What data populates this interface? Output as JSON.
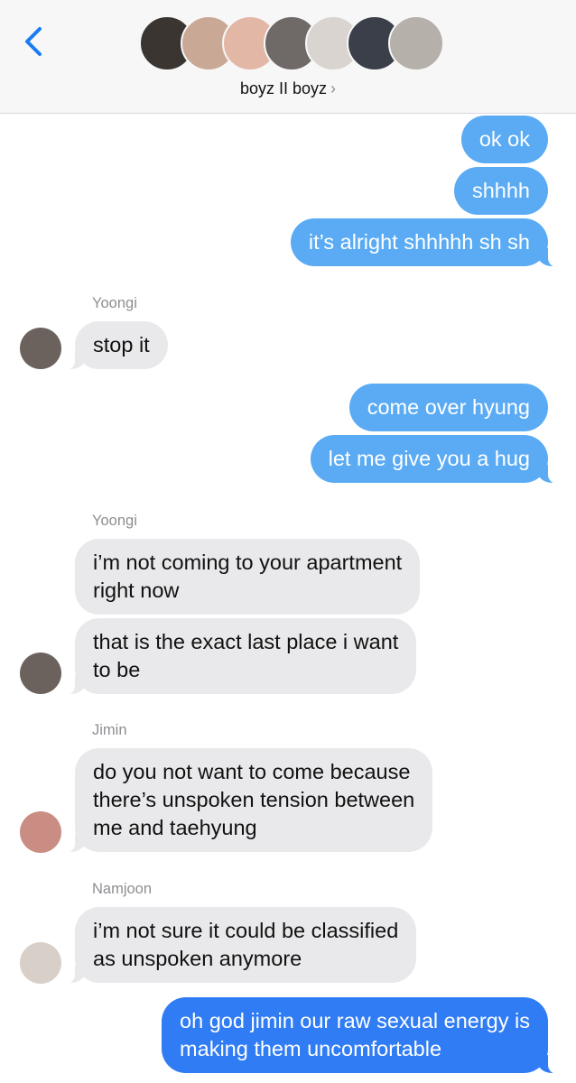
{
  "header": {
    "group_name": "boyz II boyz",
    "chevron": "›",
    "back_icon": "chevron-left-icon",
    "avatar_colors": [
      "#3b3532",
      "#c9a996",
      "#e3b7a6",
      "#6f6a68",
      "#d9d4cf",
      "#3a3f4a",
      "#b6b0aa"
    ]
  },
  "messages": [
    {
      "from": "me",
      "text": "ok ok"
    },
    {
      "from": "me",
      "text": "shhhh"
    },
    {
      "from": "me",
      "text": "it’s alright shhhhh sh sh"
    },
    {
      "sender": "Yoongi",
      "text": "stop it"
    },
    {
      "from": "me",
      "text": "come over hyung"
    },
    {
      "from": "me",
      "text": "let me give you a hug"
    },
    {
      "sender": "Yoongi",
      "text": "i’m not coming to your apartment\nright now"
    },
    {
      "sender": "Yoongi",
      "text": "that is the exact last place i want\nto be"
    },
    {
      "sender": "Jimin",
      "text": "do you not want to come because\nthere’s unspoken tension between\nme and taehyung"
    },
    {
      "sender": "Namjoon",
      "text": "i’m not sure it could be classified\nas unspoken anymore"
    },
    {
      "from": "me",
      "text": "oh god jimin our raw sexual energy is\nmaking them uncomfortable"
    }
  ],
  "colors": {
    "sent": "#5aabf4",
    "sent_latest": "#2f7cf4",
    "received": "#e9e9eb",
    "accent": "#1a7cf5"
  }
}
